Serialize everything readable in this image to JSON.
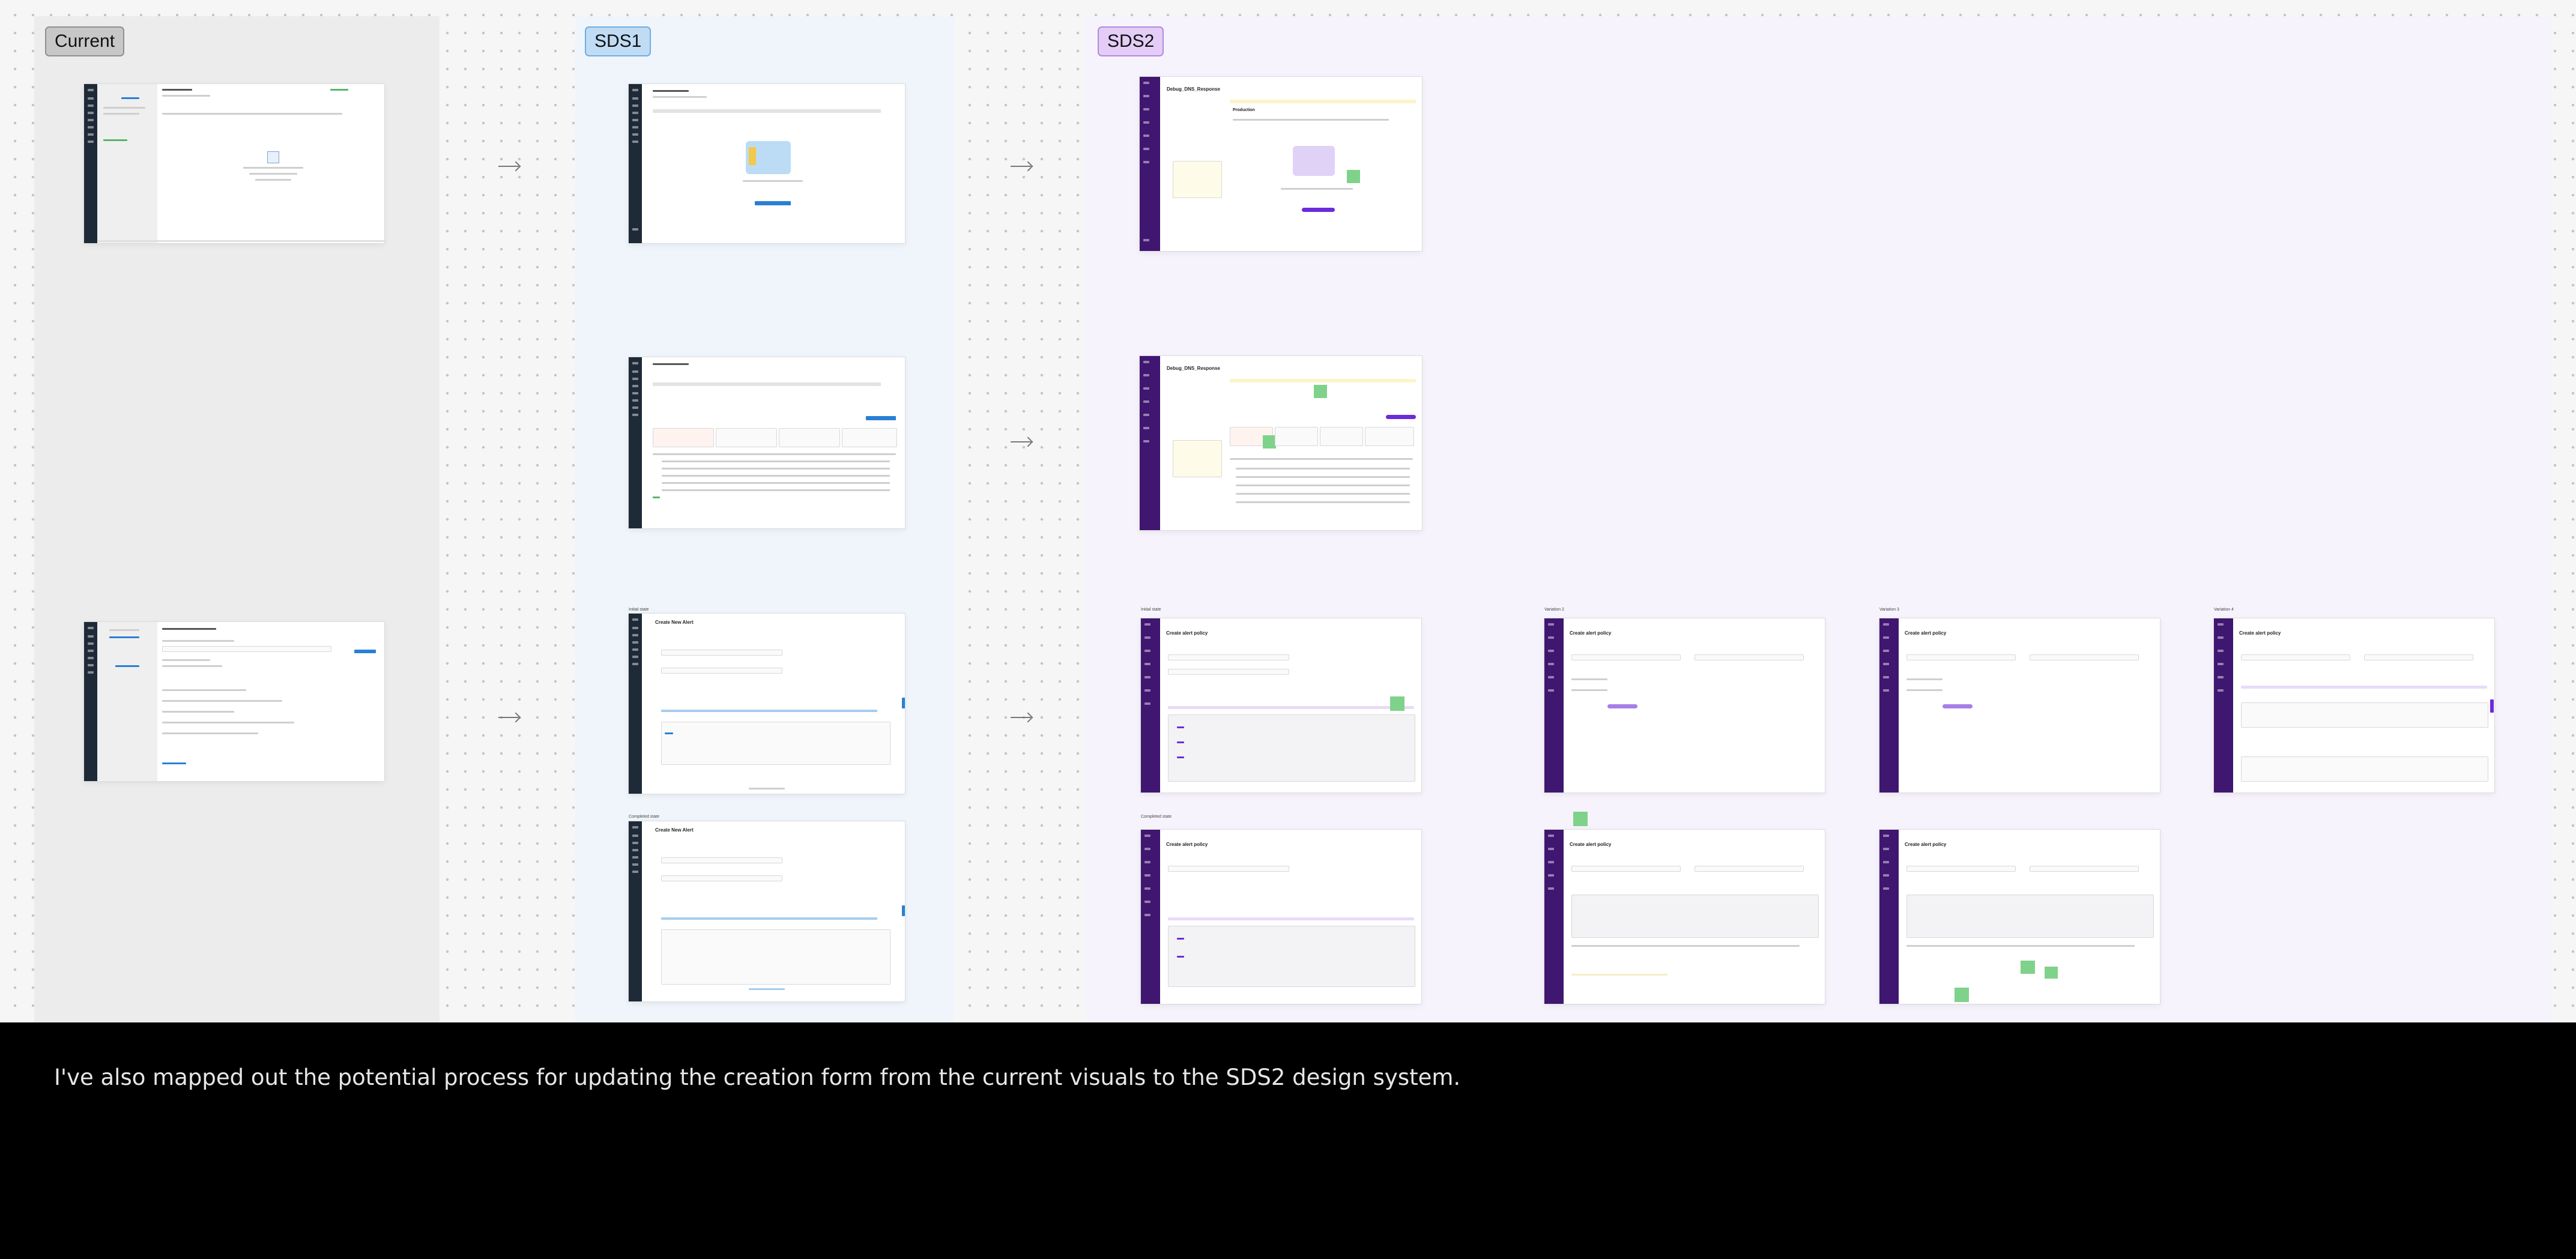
{
  "board": {
    "sections": [
      {
        "id": "current",
        "label": "Current"
      },
      {
        "id": "sds1",
        "label": "SDS1"
      },
      {
        "id": "sds2",
        "label": "SDS2"
      }
    ],
    "frame_labels": {
      "initial_state": "Initial state",
      "completed_state": "Completed state",
      "variation_2": "Variation 2",
      "variation_3": "Variation 3",
      "variation_4": "Variation 4"
    },
    "thumb_text": {
      "sds2_title": "Debug_DNS_Response",
      "sds2_subtitle": "Production",
      "create_alert_policy": "Create alert policy",
      "create_new_alert": "Create New Alert"
    }
  },
  "caption": {
    "text": "I've also mapped out the potential process for updating the creation form from the current visuals to the SDS2 design system."
  },
  "colors": {
    "current_tag": "#c7c7c7",
    "sds1_tag": "#bfdcf4",
    "sds2_tag": "#e3cdf7",
    "sds1_sidebar": "#1f2a38",
    "sds2_sidebar": "#3f1670",
    "sds1_accent": "#2a7fd4",
    "sds2_accent": "#6c2bd9",
    "sticky_note": "#7fd28a"
  }
}
